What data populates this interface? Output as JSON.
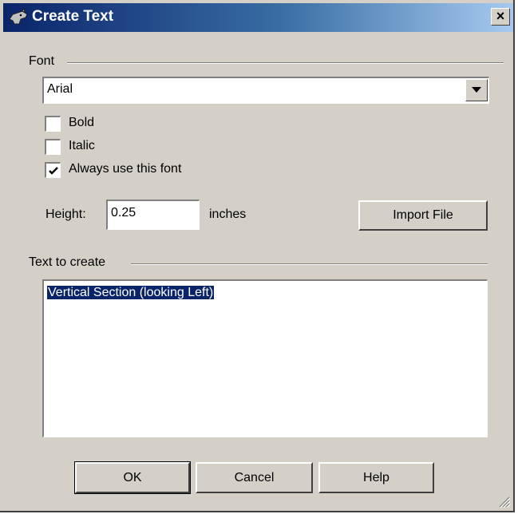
{
  "window": {
    "title": "Create Text",
    "close_label": "×"
  },
  "font_group": {
    "label": "Font",
    "selected_font": "Arial",
    "options": {
      "bold_label": "Bold",
      "bold_checked": false,
      "italic_label": "Italic",
      "italic_checked": false,
      "always_label": "Always use this font",
      "always_checked": true
    }
  },
  "height": {
    "label": "Height:",
    "value": "0.25",
    "unit": "inches"
  },
  "import_button": "Import File",
  "text_group": {
    "label": "Text to create",
    "content": "Vertical Section (looking Left)"
  },
  "buttons": {
    "ok": "OK",
    "cancel": "Cancel",
    "help": "Help"
  },
  "icons": {
    "title": "rhino-app-icon",
    "dropdown": "chevron-down-icon",
    "check": "checkmark-icon",
    "grip": "resize-grip-icon"
  },
  "colors": {
    "dialog_face": "#d4d0c8",
    "title_start": "#0a246a",
    "selection": "#0a246a"
  }
}
